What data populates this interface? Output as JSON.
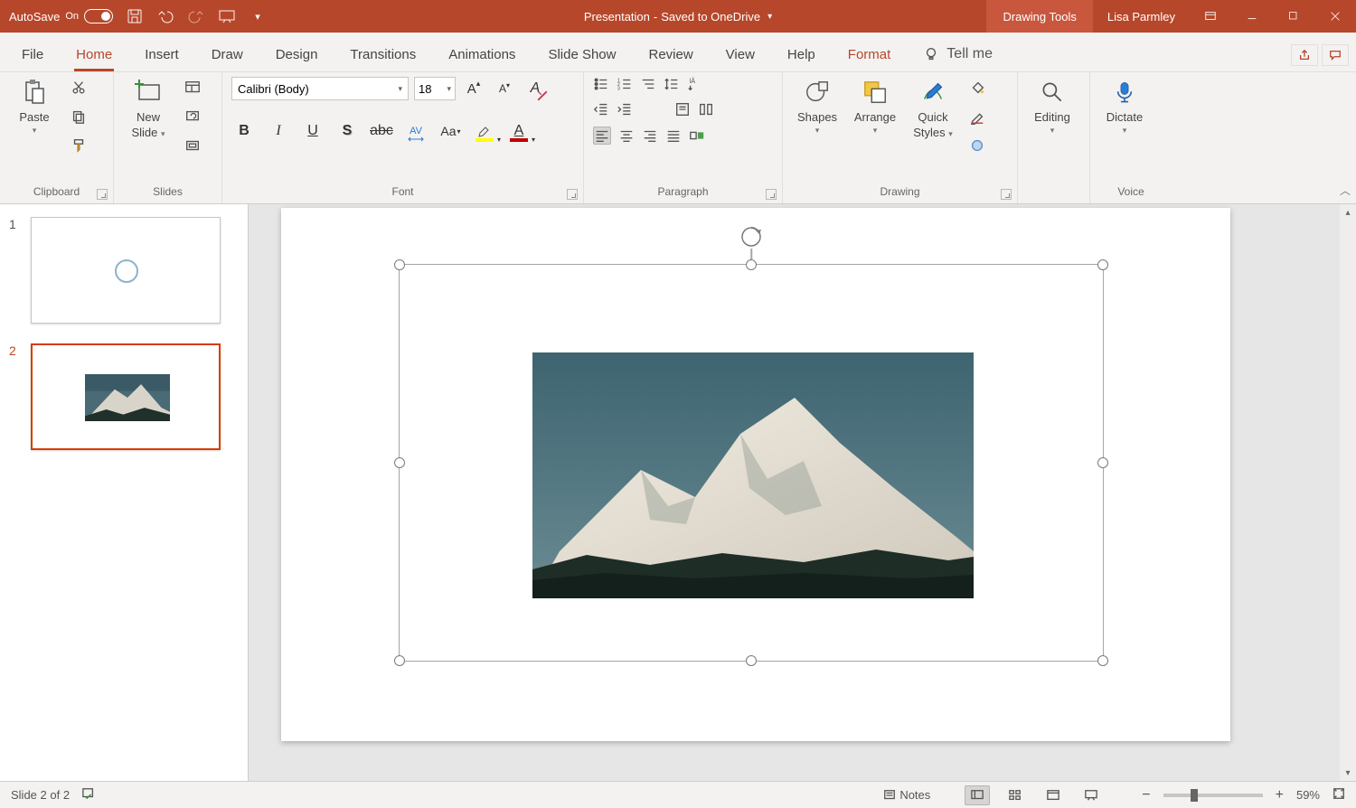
{
  "titlebar": {
    "autosave_label": "AutoSave",
    "autosave_state": "On",
    "doc_title": "Presentation",
    "save_loc_sep": " - ",
    "save_loc": "Saved to OneDrive",
    "tool_context": "Drawing Tools",
    "username": "Lisa Parmley"
  },
  "tabs": {
    "items": [
      "File",
      "Home",
      "Insert",
      "Draw",
      "Design",
      "Transitions",
      "Animations",
      "Slide Show",
      "Review",
      "View",
      "Help",
      "Format"
    ],
    "active_index": 1,
    "format_index": 11,
    "tell_me": "Tell me"
  },
  "ribbon": {
    "clipboard": {
      "label": "Clipboard",
      "paste": "Paste"
    },
    "slides": {
      "label": "Slides",
      "new_slide_line1": "New",
      "new_slide_line2": "Slide"
    },
    "font": {
      "label": "Font",
      "name": "Calibri (Body)",
      "size": "18"
    },
    "paragraph": {
      "label": "Paragraph"
    },
    "drawing": {
      "label": "Drawing",
      "shapes": "Shapes",
      "arrange": "Arrange",
      "quick_styles_l1": "Quick",
      "quick_styles_l2": "Styles"
    },
    "editing": {
      "label": "Editing",
      "btn": "Editing"
    },
    "voice": {
      "label": "Voice",
      "dictate": "Dictate"
    }
  },
  "thumbs": {
    "items": [
      {
        "num": "1"
      },
      {
        "num": "2"
      }
    ],
    "selected_index": 1
  },
  "status": {
    "slide_info": "Slide 2 of 2",
    "notes": "Notes",
    "zoom": "59%"
  }
}
